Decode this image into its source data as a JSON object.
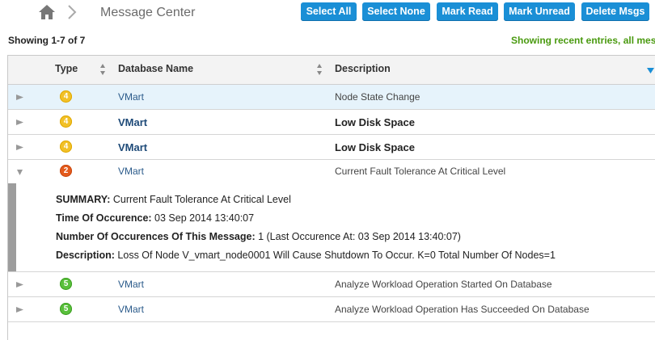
{
  "header": {
    "title": "Message Center",
    "buttons": {
      "select_all": "Select All",
      "select_none": "Select None",
      "mark_read": "Mark Read",
      "mark_unread": "Mark Unread",
      "delete_msgs": "Delete Msgs"
    }
  },
  "status": {
    "showing": "Showing 1-7 of 7",
    "recent": "Showing recent entries, all messa"
  },
  "table": {
    "columns": {
      "type": "Type",
      "database": "Database Name",
      "description": "Description"
    },
    "rows": [
      {
        "type": "4",
        "severity": "warning",
        "database": "VMart",
        "description": "Node State Change"
      },
      {
        "type": "4",
        "severity": "warning",
        "database": "VMart",
        "description": "Low Disk Space"
      },
      {
        "type": "4",
        "severity": "warning",
        "database": "VMart",
        "description": "Low Disk Space"
      },
      {
        "type": "2",
        "severity": "critical",
        "database": "VMart",
        "description": "Current Fault Tolerance At Critical Level"
      },
      {
        "type": "5",
        "severity": "info",
        "database": "VMart",
        "description": "Analyze Workload Operation Started On Database"
      },
      {
        "type": "5",
        "severity": "info",
        "database": "VMart",
        "description": "Analyze Workload Operation Has Succeeded On Database"
      }
    ],
    "details": {
      "summary_label": "SUMMARY:",
      "summary_value": "Current Fault Tolerance At Critical Level",
      "time_label": "Time Of Occurence:",
      "time_value": "03 Sep 2014 13:40:07",
      "count_label": "Number Of Occurences Of This Message:",
      "count_value": "1 (Last Occurence At: 03 Sep 2014 13:40:07)",
      "description_label": "Description:",
      "description_value": "Loss Of Node V_vmart_node0001 Will Cause Shutdown To Occur. K=0 Total Number Of Nodes=1"
    }
  },
  "colors": {
    "button_blue": "#1a8fd6",
    "warning": "#f2c128",
    "critical": "#e45b1c",
    "info": "#59c03c",
    "recent_green": "#4a9a10"
  }
}
